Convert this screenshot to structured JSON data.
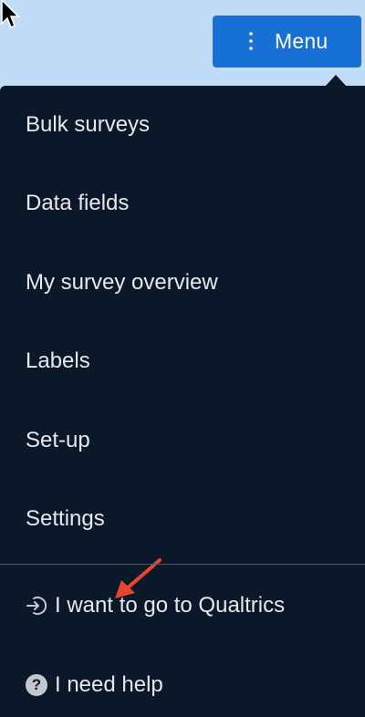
{
  "header": {
    "menu_button_label": "Menu"
  },
  "dropdown": {
    "items": [
      {
        "label": "Bulk surveys"
      },
      {
        "label": "Data fields"
      },
      {
        "label": "My survey overview"
      },
      {
        "label": "Labels"
      },
      {
        "label": "Set-up"
      },
      {
        "label": "Settings"
      }
    ],
    "footer": [
      {
        "label": "I want to go to Qualtrics",
        "icon": "sign-in-icon"
      },
      {
        "label": "I need help",
        "icon": "help-circle-icon"
      }
    ]
  },
  "colors": {
    "background": "#c1dcf7",
    "menu_button": "#1770d6",
    "dropdown_background": "#0b1829",
    "item_text": "#e6e8eb",
    "annotation_arrow": "#e8452c"
  }
}
